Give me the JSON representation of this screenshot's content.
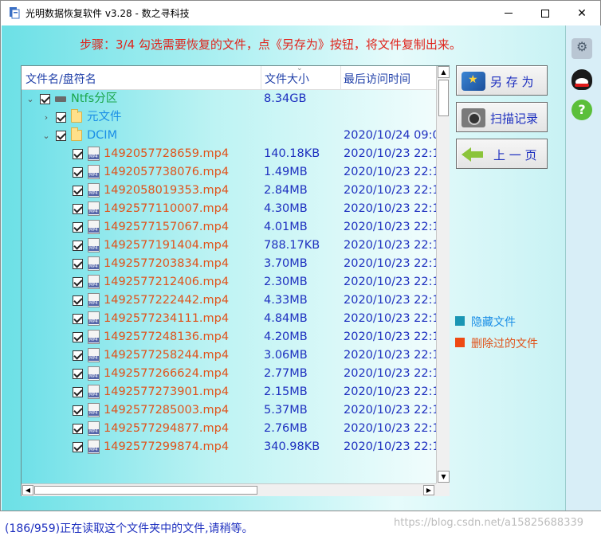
{
  "window": {
    "title": "光明数据恢复软件 v3.28 - 数之寻科技",
    "minimize_label": "—",
    "maximize_label": "☐",
    "close_label": "✕"
  },
  "step_text": "步骤：3/4 勾选需要恢复的文件，点《另存为》按钮，将文件复制出来。",
  "list": {
    "columns": [
      "文件名/盘符名",
      "文件大小",
      "最后访问时间"
    ],
    "rows": [
      {
        "level": 0,
        "expander": "⌄",
        "icon": "drive-icon",
        "name": "Ntfs分区",
        "kind": "drive",
        "size": "8.34GB",
        "time": ""
      },
      {
        "level": 1,
        "expander": "›",
        "icon": "folder-icon",
        "name": "元文件",
        "kind": "folder",
        "size": "",
        "time": ""
      },
      {
        "level": 1,
        "expander": "⌄",
        "icon": "folder-icon",
        "name": "DCIM",
        "kind": "folder",
        "size": "",
        "time": "2020/10/24 09:0"
      },
      {
        "level": 2,
        "icon": "mp4-file-icon",
        "name": "1492057728659.mp4",
        "kind": "deleted",
        "size": "140.18KB",
        "time": "2020/10/23 22:1"
      },
      {
        "level": 2,
        "icon": "mp4-file-icon",
        "name": "1492057738076.mp4",
        "kind": "deleted",
        "size": "1.49MB",
        "time": "2020/10/23 22:1"
      },
      {
        "level": 2,
        "icon": "mp4-file-icon",
        "name": "1492058019353.mp4",
        "kind": "deleted",
        "size": "2.84MB",
        "time": "2020/10/23 22:1"
      },
      {
        "level": 2,
        "icon": "mp4-file-icon",
        "name": "1492577110007.mp4",
        "kind": "deleted",
        "size": "4.30MB",
        "time": "2020/10/23 22:1"
      },
      {
        "level": 2,
        "icon": "mp4-file-icon",
        "name": "1492577157067.mp4",
        "kind": "deleted",
        "size": "4.01MB",
        "time": "2020/10/23 22:1"
      },
      {
        "level": 2,
        "icon": "mp4-file-icon",
        "name": "1492577191404.mp4",
        "kind": "deleted",
        "size": "788.17KB",
        "time": "2020/10/23 22:1"
      },
      {
        "level": 2,
        "icon": "mp4-file-icon",
        "name": "1492577203834.mp4",
        "kind": "deleted",
        "size": "3.70MB",
        "time": "2020/10/23 22:1"
      },
      {
        "level": 2,
        "icon": "mp4-file-icon",
        "name": "1492577212406.mp4",
        "kind": "deleted",
        "size": "2.30MB",
        "time": "2020/10/23 22:1"
      },
      {
        "level": 2,
        "icon": "mp4-file-icon",
        "name": "1492577222442.mp4",
        "kind": "deleted",
        "size": "4.33MB",
        "time": "2020/10/23 22:1"
      },
      {
        "level": 2,
        "icon": "mp4-file-icon",
        "name": "1492577234111.mp4",
        "kind": "deleted",
        "size": "4.84MB",
        "time": "2020/10/23 22:1"
      },
      {
        "level": 2,
        "icon": "mp4-file-icon",
        "name": "1492577248136.mp4",
        "kind": "deleted",
        "size": "4.20MB",
        "time": "2020/10/23 22:1"
      },
      {
        "level": 2,
        "icon": "mp4-file-icon",
        "name": "1492577258244.mp4",
        "kind": "deleted",
        "size": "3.06MB",
        "time": "2020/10/23 22:1"
      },
      {
        "level": 2,
        "icon": "mp4-file-icon",
        "name": "1492577266624.mp4",
        "kind": "deleted",
        "size": "2.77MB",
        "time": "2020/10/23 22:1"
      },
      {
        "level": 2,
        "icon": "mp4-file-icon",
        "name": "1492577273901.mp4",
        "kind": "deleted",
        "size": "2.15MB",
        "time": "2020/10/23 22:1"
      },
      {
        "level": 2,
        "icon": "mp4-file-icon",
        "name": "1492577285003.mp4",
        "kind": "deleted",
        "size": "5.37MB",
        "time": "2020/10/23 22:1"
      },
      {
        "level": 2,
        "icon": "mp4-file-icon",
        "name": "1492577294877.mp4",
        "kind": "deleted",
        "size": "2.76MB",
        "time": "2020/10/23 22:1"
      },
      {
        "level": 2,
        "icon": "mp4-file-icon",
        "name": "1492577299874.mp4",
        "kind": "deleted",
        "size": "340.98KB",
        "time": "2020/10/23 22:1"
      }
    ]
  },
  "buttons": {
    "save_as": "另 存 为",
    "scan_record": "扫描记录",
    "prev_page": "上 一 页"
  },
  "legend": {
    "hidden": {
      "label": "隐藏文件",
      "color": "#1a96b4"
    },
    "deleted": {
      "label": "删除过的文件",
      "color": "#ee4a13"
    }
  },
  "status_text": "(186/959)正在读取这个文件夹中的文件,请稍等。",
  "watermark": "https://blog.csdn.net/a15825688339"
}
